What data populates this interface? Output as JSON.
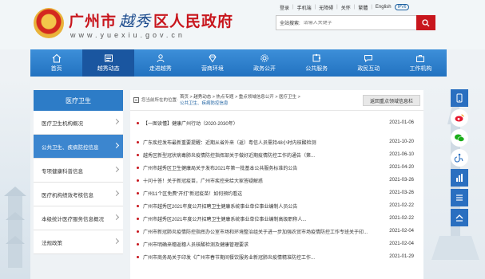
{
  "header": {
    "title_left": "广州市",
    "title_calligraphy": "越秀",
    "title_right": "区人民政府",
    "url": "www.yuexiu.gov.cn"
  },
  "toplinks": [
    "登录",
    "手机端",
    "无障碍",
    "关怀",
    "繁體",
    "English",
    "IPV6"
  ],
  "search": {
    "label": "全站搜索:",
    "placeholder": "请输入关键字"
  },
  "nav": [
    {
      "label": "首页",
      "icon": "home-icon"
    },
    {
      "label": "越秀动态",
      "icon": "news-icon"
    },
    {
      "label": "走进越秀",
      "icon": "people-icon"
    },
    {
      "label": "营商环境",
      "icon": "diamond-icon"
    },
    {
      "label": "政务公开",
      "icon": "gear-icon"
    },
    {
      "label": "公共服务",
      "icon": "puzzle-icon"
    },
    {
      "label": "政民互动",
      "icon": "chat-icon"
    },
    {
      "label": "工作机构",
      "icon": "briefcase-icon"
    }
  ],
  "sidebar": {
    "heading": "医疗卫生",
    "items": [
      "医疗卫生机构概况",
      "公共卫生、疾病防控信息",
      "专项健康科普信息",
      "医疗机构绩效考核信息",
      "本级统计医疗服务信息概况",
      "法规政策"
    ],
    "active_index": 1
  },
  "breadcrumb": {
    "location_label": "您当前所在的位置:",
    "path_line1": "首页 > 越秀动态 > 热点专题 > 重点领域信息公开 > 医疗卫生 >",
    "path_line2": "公共卫生、疾病防控信息",
    "back_button": "返回重点领域信息栏"
  },
  "news": [
    {
      "title": "【一图读懂】健康广州行动（2020-2030年）",
      "date": "2021-01-06"
    },
    {
      "title": "广东疾控发布最新重要提醒：近期从省外来（返）粤信人员需持48小时内核酸检测",
      "date": "2021-10-20"
    },
    {
      "title": "越秀区新型冠状病毒肺炎疫情防控指挥部关于做好近期疫情防控工作的通告（第...",
      "date": "2021-06-10"
    },
    {
      "title": "广州市越秀区卫生健康局关于发布2021年第一批基本公共服务标准的公告",
      "date": "2021-04-20"
    },
    {
      "title": "十问十答！关于新冠疫苗，广州市疾控来给大家答疑解惑",
      "date": "2021-03-26"
    },
    {
      "title": "广州11个区免费“开打”新冠疫苗！如何预约看这",
      "date": "2021-03-26"
    },
    {
      "title": "广州市越秀区2021年度公开招聘卫生健康系统事业单位事业编制人员公告",
      "date": "2021-02-22"
    },
    {
      "title": "广州市越秀区2021年度公开招聘卫生健康系统事业单位事业编制高级职称人...",
      "date": "2021-02-22"
    },
    {
      "title": "广州市新冠肺炎疫情防控指挥办公室市场和环境整治组关于进一步加强农贸市场疫情防控工作专班关于印...",
      "date": "2021-02-04"
    },
    {
      "title": "广州市明确来穗返穗人员核酸检测及健康管理要求",
      "date": "2021-02-04"
    },
    {
      "title": "广州市商务局关于印发《广州市春节期间餐饮服务业新冠肺炎疫情精准防控工作...",
      "date": "2021-01-29"
    }
  ],
  "right_toolbar": [
    "app-icon",
    "weibo-icon",
    "wechat-icon",
    "accessibility-icon",
    "stats-icon",
    "list-icon",
    "top-icon"
  ],
  "colors": {
    "brand_red": "#c8161d",
    "nav_blue": "#2d7cc7",
    "active_blue": "#1a56a0"
  }
}
